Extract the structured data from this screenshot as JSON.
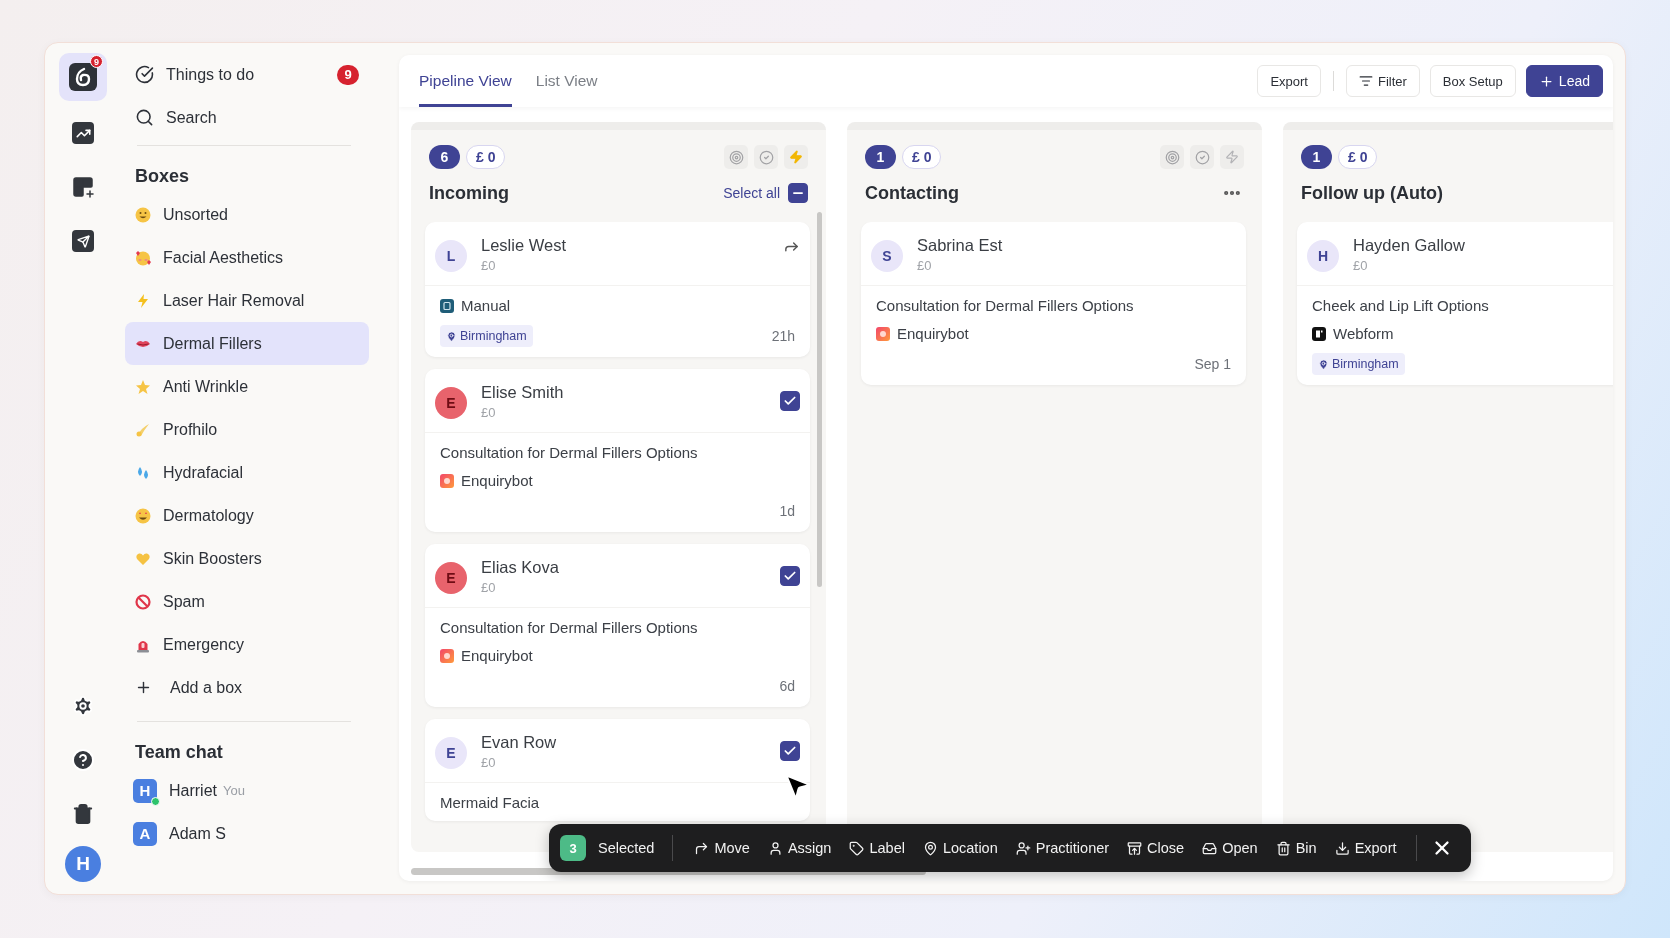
{
  "rail": {
    "logo_badge": "9",
    "avatar": "H"
  },
  "sidebar": {
    "things_to_do": {
      "label": "Things to do",
      "count": "9"
    },
    "search": "Search",
    "boxes_title": "Boxes",
    "boxes": [
      {
        "label": "Unsorted",
        "selected": false
      },
      {
        "label": "Facial Aesthetics",
        "selected": false
      },
      {
        "label": "Laser Hair Removal",
        "selected": false
      },
      {
        "label": "Dermal Fillers",
        "selected": true
      },
      {
        "label": "Anti Wrinkle",
        "selected": false
      },
      {
        "label": "Profhilo",
        "selected": false
      },
      {
        "label": "Hydrafacial",
        "selected": false
      },
      {
        "label": "Dermatology",
        "selected": false
      },
      {
        "label": "Skin Boosters",
        "selected": false
      },
      {
        "label": "Spam",
        "selected": false
      },
      {
        "label": "Emergency",
        "selected": false
      }
    ],
    "add_box": "Add a box",
    "team_chat_title": "Team chat",
    "members": [
      {
        "initial": "H",
        "name": "Harriet",
        "note": "You",
        "online": true
      },
      {
        "initial": "A",
        "name": "Adam S",
        "online": false
      }
    ]
  },
  "tabs": [
    {
      "label": "Pipeline View",
      "selected": true
    },
    {
      "label": "List View",
      "selected": false
    }
  ],
  "toolbar": {
    "export": "Export",
    "filter": "Filter",
    "box_setup": "Box Setup",
    "lead": "Lead"
  },
  "columns": [
    {
      "title": "Incoming",
      "count": "6",
      "value": "£ 0",
      "automation_on": true,
      "select_all": {
        "label": "Select all",
        "indeterminate": true
      },
      "cards": [
        {
          "initial": "L",
          "color": "#e9e6f9",
          "name": "Leslie West",
          "amount": "£0",
          "forward": true,
          "source": {
            "kind": "manual",
            "label": "Manual"
          },
          "location": "Birmingham",
          "age": "21h"
        },
        {
          "initial": "E",
          "color": "#e8636c",
          "name": "Elise Smith",
          "amount": "£0",
          "checked": true,
          "subject": "Consultation for Dermal Fillers Options",
          "source": {
            "kind": "enquirybot",
            "label": "Enquirybot"
          },
          "age": "1d"
        },
        {
          "initial": "E",
          "color": "#e8636c",
          "name": "Elias Kova",
          "amount": "£0",
          "checked": true,
          "subject": "Consultation for Dermal Fillers Options",
          "source": {
            "kind": "enquirybot",
            "label": "Enquirybot"
          },
          "age": "6d"
        },
        {
          "initial": "E",
          "color": "#e9e6f9",
          "name": "Evan Row",
          "amount": "£0",
          "checked": true,
          "subject": "Mermaid Facia"
        }
      ]
    },
    {
      "title": "Contacting",
      "count": "1",
      "value": "£ 0",
      "automation_on": false,
      "menu": true,
      "cards": [
        {
          "initial": "S",
          "color": "#e9e6f9",
          "name": "Sabrina Est",
          "amount": "£0",
          "subject": "Consultation for Dermal Fillers Options",
          "source": {
            "kind": "enquirybot",
            "label": "Enquirybot"
          },
          "age": "Sep 1"
        }
      ]
    },
    {
      "title": "Follow up (Auto)",
      "count": "1",
      "value": "£ 0",
      "cards": [
        {
          "initial": "H",
          "color": "#e9e6f9",
          "name": "Hayden Gallow",
          "amount": "£0",
          "subject": "Cheek and Lip Lift Options",
          "source": {
            "kind": "webform",
            "label": "Webform"
          },
          "location": "Birmingham"
        }
      ]
    }
  ],
  "action_bar": {
    "count": "3",
    "label": "Selected",
    "actions": [
      {
        "kind": "move",
        "label": "Move"
      },
      {
        "kind": "assign",
        "label": "Assign"
      },
      {
        "kind": "label",
        "label": "Label"
      },
      {
        "kind": "location",
        "label": "Location"
      },
      {
        "kind": "practitioner",
        "label": "Practitioner"
      },
      {
        "kind": "close",
        "label": "Close"
      },
      {
        "kind": "open",
        "label": "Open"
      },
      {
        "kind": "bin",
        "label": "Bin"
      },
      {
        "kind": "export",
        "label": "Export"
      }
    ]
  }
}
